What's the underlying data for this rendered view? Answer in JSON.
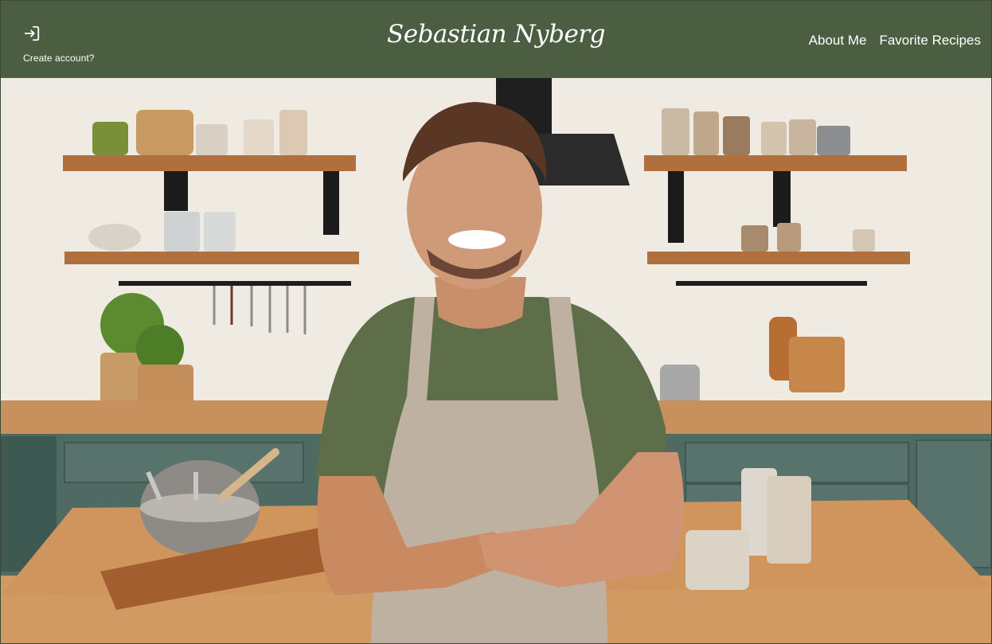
{
  "header": {
    "login_icon": "login-arrow-icon",
    "create_account_label": "Create account?",
    "brand": "Sebastian Nyberg",
    "nav": [
      {
        "label": "About Me"
      },
      {
        "label": "Favorite Recipes"
      }
    ]
  },
  "hero": {
    "image": "Chef in apron standing in a kitchen with arms crossed"
  },
  "colors": {
    "header_bg": "#4b5e42",
    "header_text": "#ffffff"
  }
}
